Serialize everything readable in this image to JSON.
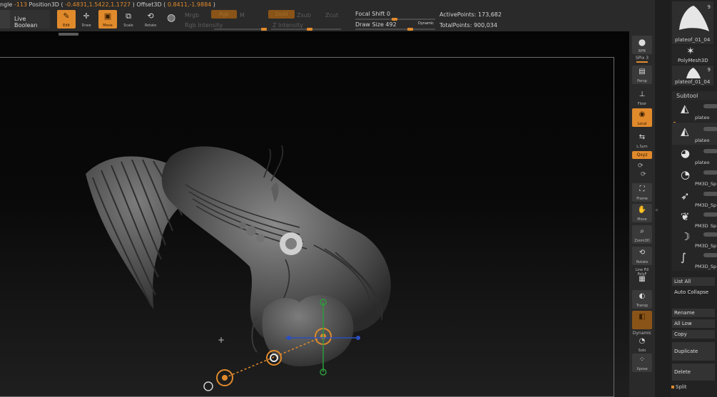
{
  "top": {
    "angle_prefix": "ngle",
    "angle_value": "-113",
    "position_label": "Position3D (",
    "position_value": "-0.4831,1.5422,1.1727",
    "offset_label": ") Offset3D (",
    "offset_value": "0.8411,-1.9884",
    "offset_close": ")",
    "live_boolean": "Live Boolean",
    "tools": [
      {
        "name": "edit",
        "label": "Edit",
        "icon": "edit-icon",
        "active": true
      },
      {
        "name": "draw",
        "label": "Draw",
        "icon": "draw-icon",
        "active": false
      },
      {
        "name": "move",
        "label": "Move",
        "icon": "move-icon",
        "active": true
      },
      {
        "name": "scale",
        "label": "Scale",
        "icon": "scale-icon",
        "active": false
      },
      {
        "name": "rotate",
        "label": "Rotate",
        "icon": "rotate-icon",
        "active": false
      },
      {
        "name": "gizmo",
        "label": "",
        "icon": "gizmo-icon",
        "active": false
      }
    ],
    "mrgb": "Mrgb",
    "rgb": "Rgb",
    "m": "M",
    "rgb_intensity": "Rgb Intensity",
    "zadd": "Zadd",
    "zsub": "Zsub",
    "zcut": "Zcut",
    "z_intensity": "Z Intensity",
    "focal_shift_label": "Focal Shift",
    "focal_shift_value": "0",
    "draw_size_label": "Draw Size",
    "draw_size_value": "492",
    "dynamic": "Dynamic",
    "active_points_label": "ActivePoints:",
    "active_points_value": "173,682",
    "total_points_label": "TotalPoints:",
    "total_points_value": "900,034"
  },
  "shelf": {
    "items": [
      {
        "name": "bpr",
        "label": "BPR",
        "icon": "sphere-icon",
        "active": false
      },
      {
        "name": "spix",
        "label": "SPix 3",
        "icon": "",
        "active": false
      },
      {
        "name": "persp",
        "label": "Persp",
        "icon": "persp-icon",
        "active": false
      },
      {
        "name": "floor",
        "label": "Floor",
        "icon": "floor-icon",
        "active": false
      },
      {
        "name": "local",
        "label": "Local",
        "icon": "local-icon",
        "active": true
      },
      {
        "name": "lsym",
        "label": "L.Sym",
        "icon": "lsym-icon",
        "active": false
      },
      {
        "name": "qxyz",
        "label": "Qxyz",
        "icon": "",
        "active": true
      },
      {
        "name": "frame",
        "label": "Frame",
        "icon": "frame-icon",
        "active": false
      },
      {
        "name": "move",
        "label": "Move",
        "icon": "hand-icon",
        "active": false
      },
      {
        "name": "zoom3d",
        "label": "Zoom3D",
        "icon": "zoom-icon",
        "active": false
      },
      {
        "name": "rotate",
        "label": "Rotate",
        "icon": "rotate-icon",
        "active": false
      },
      {
        "name": "linefill",
        "label": "Line Fill PolyF",
        "icon": "polyf-icon",
        "active": false
      },
      {
        "name": "transp",
        "label": "Transp",
        "icon": "transp-icon",
        "active": false
      },
      {
        "name": "ghost",
        "label": "",
        "icon": "ghost-icon",
        "active": true
      },
      {
        "name": "solo",
        "label": "Solo",
        "icon": "solo-icon",
        "active": false
      },
      {
        "name": "xpose",
        "label": "Xpose",
        "icon": "xpose-icon",
        "active": false
      }
    ],
    "dynamic_label": "Dynamic"
  },
  "panel": {
    "tool_count_1": "9",
    "tool_name_1": "plateof_01_04",
    "polymesh": "PolyMesh3D",
    "tool_count_2": "9",
    "tool_name_2": "plateof_01_04",
    "subtool_title": "Subtool",
    "subtools": [
      {
        "name": "plateo"
      },
      {
        "name": "plateo"
      },
      {
        "name": "plateo"
      },
      {
        "name": "PM3D_Sp"
      },
      {
        "name": "PM3D_Sp"
      },
      {
        "name": "PM3D_Sp"
      },
      {
        "name": "PM3D_Sp"
      },
      {
        "name": "PM3D_Sp"
      }
    ],
    "list_all": "List All",
    "auto_collapse": "Auto Collapse",
    "rename": "Rename",
    "all_low": "All Low",
    "copy": "Copy",
    "duplicate": "Duplicate",
    "delete": "Delete",
    "split": "Split"
  }
}
